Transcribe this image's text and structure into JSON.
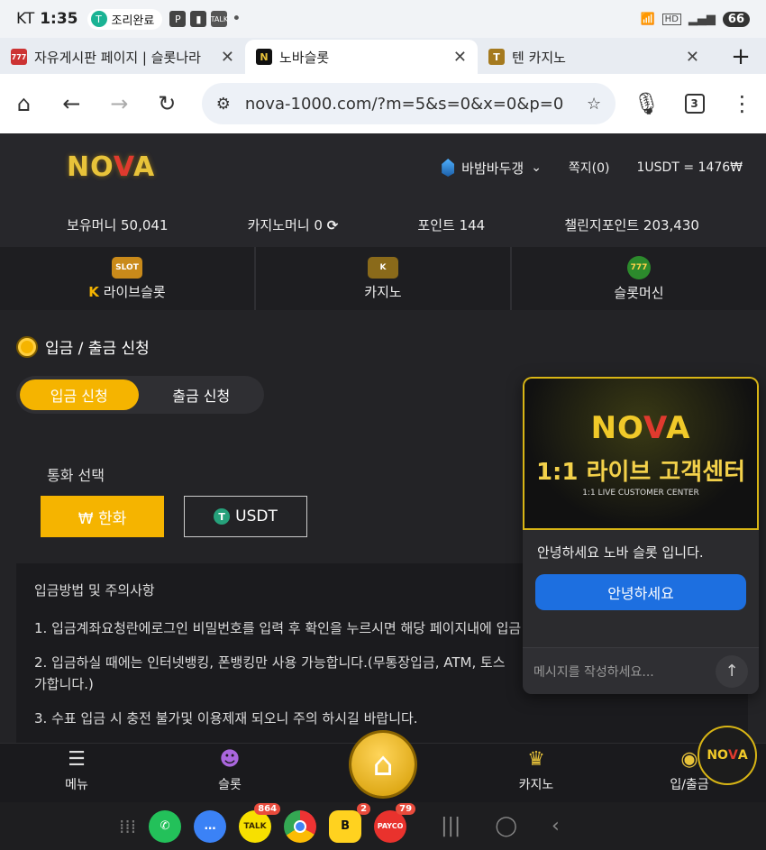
{
  "status": {
    "carrier": "KT",
    "time": "1:35",
    "notif_pill": "조리완료",
    "notif_pill_icon": "T",
    "battery": "66",
    "icons": [
      "P",
      "talk-icon"
    ]
  },
  "browser": {
    "tabs": [
      {
        "title": "자유게시판 페이지 | 슬롯나라",
        "favicon": "777"
      },
      {
        "title": "노바슬롯",
        "favicon": "N",
        "active": true
      },
      {
        "title": "텐 카지노",
        "favicon": "T"
      }
    ],
    "url": "nova-1000.com/?m=5&s=0&x=0&p=0",
    "tab_count": "3"
  },
  "site": {
    "logo_pre": "NO",
    "logo_x": "V",
    "logo_post": "A",
    "username": "바밤바두갱",
    "message": "쪽지(0)",
    "rate": "1USDT = 1476₩",
    "balances": {
      "money": "보유머니 50,041",
      "casino_money": "카지노머니 0",
      "points": "포인트 144",
      "challenge": "챌린지포인트 203,430"
    },
    "nav": [
      {
        "label": "라이브슬롯",
        "icon": "SLOT"
      },
      {
        "label": "카지노",
        "icon": "K"
      },
      {
        "label": "슬롯머신",
        "icon": "777"
      }
    ]
  },
  "page": {
    "title": "입금 / 출금 신청",
    "tab_deposit": "입금 신청",
    "tab_withdraw": "출금 신청",
    "currency_label": "통화 선택",
    "krw": "₩ 한화",
    "usdt": "USDT",
    "notice_heading": "입금방법 및 주의사항",
    "notice_1": "1. 입금계좌요청란에로그인 비밀번호를 입력 후 확인을 누르시면 해당 페이지내에 입금",
    "notice_2": "2. 입금하실 때에는 인터넷뱅킹, 폰뱅킹만 사용 가능합니다.(무통장입금, ATM, 토스",
    "notice_2b": "가합니다.)",
    "notice_3": "3. 수표 입금 시 충전 불가및 이용제재 되오니 주의 하시길 바랍니다."
  },
  "chat": {
    "banner_logo_pre": "NO",
    "banner_logo_x": "V",
    "banner_logo_post": "A",
    "banner_title": "1:1 라이브 고객센터",
    "banner_sub": "1:1 LIVE CUSTOMER CENTER",
    "greeting": "안녕하세요 노바 슬롯 입니다.",
    "reply": "안녕하세요",
    "input_placeholder": "메시지를 작성하세요..."
  },
  "bottom_nav": [
    {
      "label": "메뉴"
    },
    {
      "label": "슬롯"
    },
    {
      "label": "카지노"
    },
    {
      "label": "입/출금"
    }
  ],
  "fab": {
    "pre": "NO",
    "x": "V",
    "post": "A"
  },
  "dock": {
    "talk_badge": "864",
    "b_badge": "2",
    "payco_badge": "79",
    "payco": "PAYCO"
  },
  "colors": {
    "accent": "#f5b400",
    "chat_button": "#1d6fe0",
    "background": "#232326"
  }
}
